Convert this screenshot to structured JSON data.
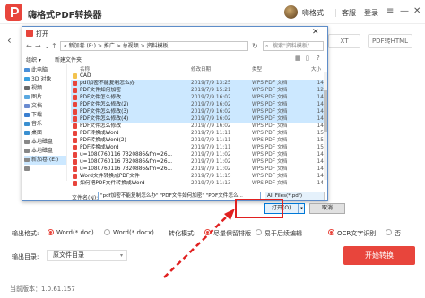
{
  "app": {
    "title": "嗨格式PDF转换器",
    "username": "嗨格式",
    "links": [
      "客服",
      "登录"
    ],
    "window_buttons": [
      "≡",
      "—",
      "✕"
    ],
    "brand_color": "#e8453c"
  },
  "bg_tabs": [
    "XT",
    "PDF转HTML"
  ],
  "dialog": {
    "title": "打开",
    "close": "✕",
    "address": "«  新加卷 (E:)  >  推广  >  总视频  >  资料模板",
    "search_placeholder": "搜索\"资料模板\"",
    "toolbar": {
      "organize": "组织 ▾",
      "new_folder": "新建文件夹"
    },
    "tree": [
      {
        "label": "此电脑",
        "color": "#4a90d9"
      },
      {
        "label": "3D 对象",
        "color": "#3aa0e0"
      },
      {
        "label": "视频",
        "color": "#6a6a6a"
      },
      {
        "label": "图片",
        "color": "#5aa8e0"
      },
      {
        "label": "文档",
        "color": "#6a8bd0"
      },
      {
        "label": "下载",
        "color": "#3a7fd0"
      },
      {
        "label": "音乐",
        "color": "#3a8fd0"
      },
      {
        "label": "桌面",
        "color": "#3a8fd0"
      },
      {
        "label": "本地磁盘",
        "color": "#888888"
      },
      {
        "label": "本地磁盘",
        "color": "#888888"
      },
      {
        "label": "新加卷 (E:)",
        "color": "#888888"
      },
      {
        "label": "",
        "color": "#888888"
      }
    ],
    "columns": {
      "name": "名称",
      "date": "修改日期",
      "type": "类型",
      "size": "大小"
    },
    "files": [
      {
        "name": "CAD",
        "date": "",
        "type": "",
        "size": "",
        "folder": true,
        "selected": false
      },
      {
        "name": "pdf加密不能复制怎么办",
        "date": "2019/7/9 13:25",
        "type": "WPS PDF 文档",
        "size": "14",
        "folder": false,
        "selected": true
      },
      {
        "name": "PDF文件如何加密",
        "date": "2019/7/9 15:21",
        "type": "WPS PDF 文档",
        "size": "12",
        "folder": false,
        "selected": true
      },
      {
        "name": "PDF文件怎么修改",
        "date": "2019/7/9 16:02",
        "type": "WPS PDF 文档",
        "size": "14",
        "folder": false,
        "selected": true
      },
      {
        "name": "PDF文件怎么修改(2)",
        "date": "2019/7/9 16:02",
        "type": "WPS PDF 文档",
        "size": "14",
        "folder": false,
        "selected": true
      },
      {
        "name": "PDF文件怎么修改(3)",
        "date": "2019/7/9 16:02",
        "type": "WPS PDF 文档",
        "size": "14",
        "folder": false,
        "selected": true
      },
      {
        "name": "PDF文件怎么修改(4)",
        "date": "2019/7/9 16:02",
        "type": "WPS PDF 文档",
        "size": "14",
        "folder": false,
        "selected": true
      },
      {
        "name": "PDF文件怎么修改",
        "date": "2019/7/9 16:02",
        "type": "WPS PDF 文档",
        "size": "14",
        "folder": false,
        "selected": false
      },
      {
        "name": "PDF转换成Word",
        "date": "2019/7/9 11:11",
        "type": "WPS PDF 文档",
        "size": "15",
        "folder": false,
        "selected": false
      },
      {
        "name": "PDF转换成Word(2)",
        "date": "2019/7/9 11:11",
        "type": "WPS PDF 文档",
        "size": "15",
        "folder": false,
        "selected": false
      },
      {
        "name": "PDF转换成Word",
        "date": "2019/7/9 11:11",
        "type": "WPS PDF 文档",
        "size": "15",
        "folder": false,
        "selected": false
      },
      {
        "name": "u=1080760116 7320886&fm=26...",
        "date": "2019/7/9 11:02",
        "type": "WPS PDF 文档",
        "size": "14",
        "folder": false,
        "selected": false
      },
      {
        "name": "u=1080760116 7320886&fm=26...",
        "date": "2019/7/9 11:02",
        "type": "WPS PDF 文档",
        "size": "14",
        "folder": false,
        "selected": false
      },
      {
        "name": "u=1080760116 7320886&fm=26...",
        "date": "2019/7/9 11:02",
        "type": "WPS PDF 文档",
        "size": "14",
        "folder": false,
        "selected": false
      },
      {
        "name": "Word文件转换成PDF文件",
        "date": "2019/7/9 11:15",
        "type": "WPS PDF 文档",
        "size": "14",
        "folder": false,
        "selected": false
      },
      {
        "name": "如何把PDF文件转换成Word",
        "date": "2019/7/9 11:13",
        "type": "WPS PDF 文档",
        "size": "14",
        "folder": false,
        "selected": false
      }
    ],
    "filename_label": "文件名(N):",
    "filename_value": "\"pdf加密不能复制怎么办\" \"PDF文件如何加密\" \"PDF文件怎么...",
    "filter": "All Files(*.pdf)",
    "open_button": "打开(O)",
    "open_dropdown": "▾",
    "cancel_button": "取消"
  },
  "options": {
    "output_format_label": "输出格式:",
    "format_word_doc": "Word(*.doc)",
    "format_word_docx": "Word(*.docx)",
    "convert_mode_label": "转化模式:",
    "mode_a": "尽量保留排版",
    "mode_b": "易于后续编辑",
    "ocr_label": "OCR文字识别:",
    "ocr_value": "否",
    "output_dir_label": "输出目录:",
    "output_dir_value": "原文件目录",
    "start_button": "开始转换",
    "version": "当前版本：1.0.61.157"
  }
}
